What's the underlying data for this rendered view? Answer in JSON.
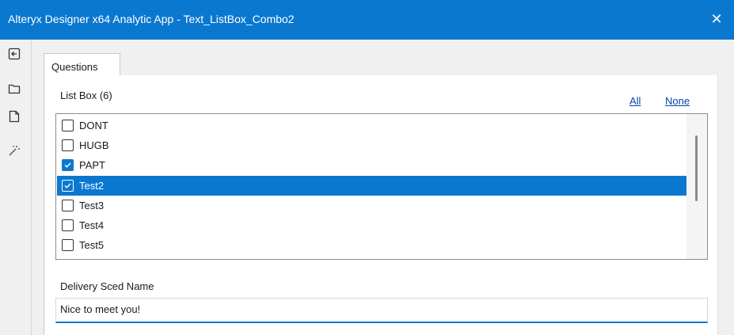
{
  "window": {
    "title": "Alteryx Designer x64 Analytic App - Text_ListBox_Combo2",
    "close_glyph": "✕"
  },
  "sidebar": {
    "icons": [
      "back-to-canvas-icon",
      "folder-open-icon",
      "document-icon",
      "magic-wand-icon"
    ]
  },
  "tabs": [
    {
      "label": "Questions",
      "active": true
    }
  ],
  "listbox": {
    "label": "List Box (6)",
    "all_link": "All",
    "none_link": "None",
    "items": [
      {
        "label": "DONT",
        "checked": false,
        "selected": false
      },
      {
        "label": "HUGB",
        "checked": false,
        "selected": false
      },
      {
        "label": "PAPT",
        "checked": true,
        "selected": false
      },
      {
        "label": "Test2",
        "checked": true,
        "selected": true
      },
      {
        "label": "Test3",
        "checked": false,
        "selected": false
      },
      {
        "label": "Test4",
        "checked": false,
        "selected": false
      },
      {
        "label": "Test5",
        "checked": false,
        "selected": false
      }
    ]
  },
  "delivery": {
    "label": "Delivery Sced Name",
    "value": "Nice to meet you!"
  },
  "colors": {
    "accent": "#0b78d0",
    "link": "#0645ad"
  }
}
